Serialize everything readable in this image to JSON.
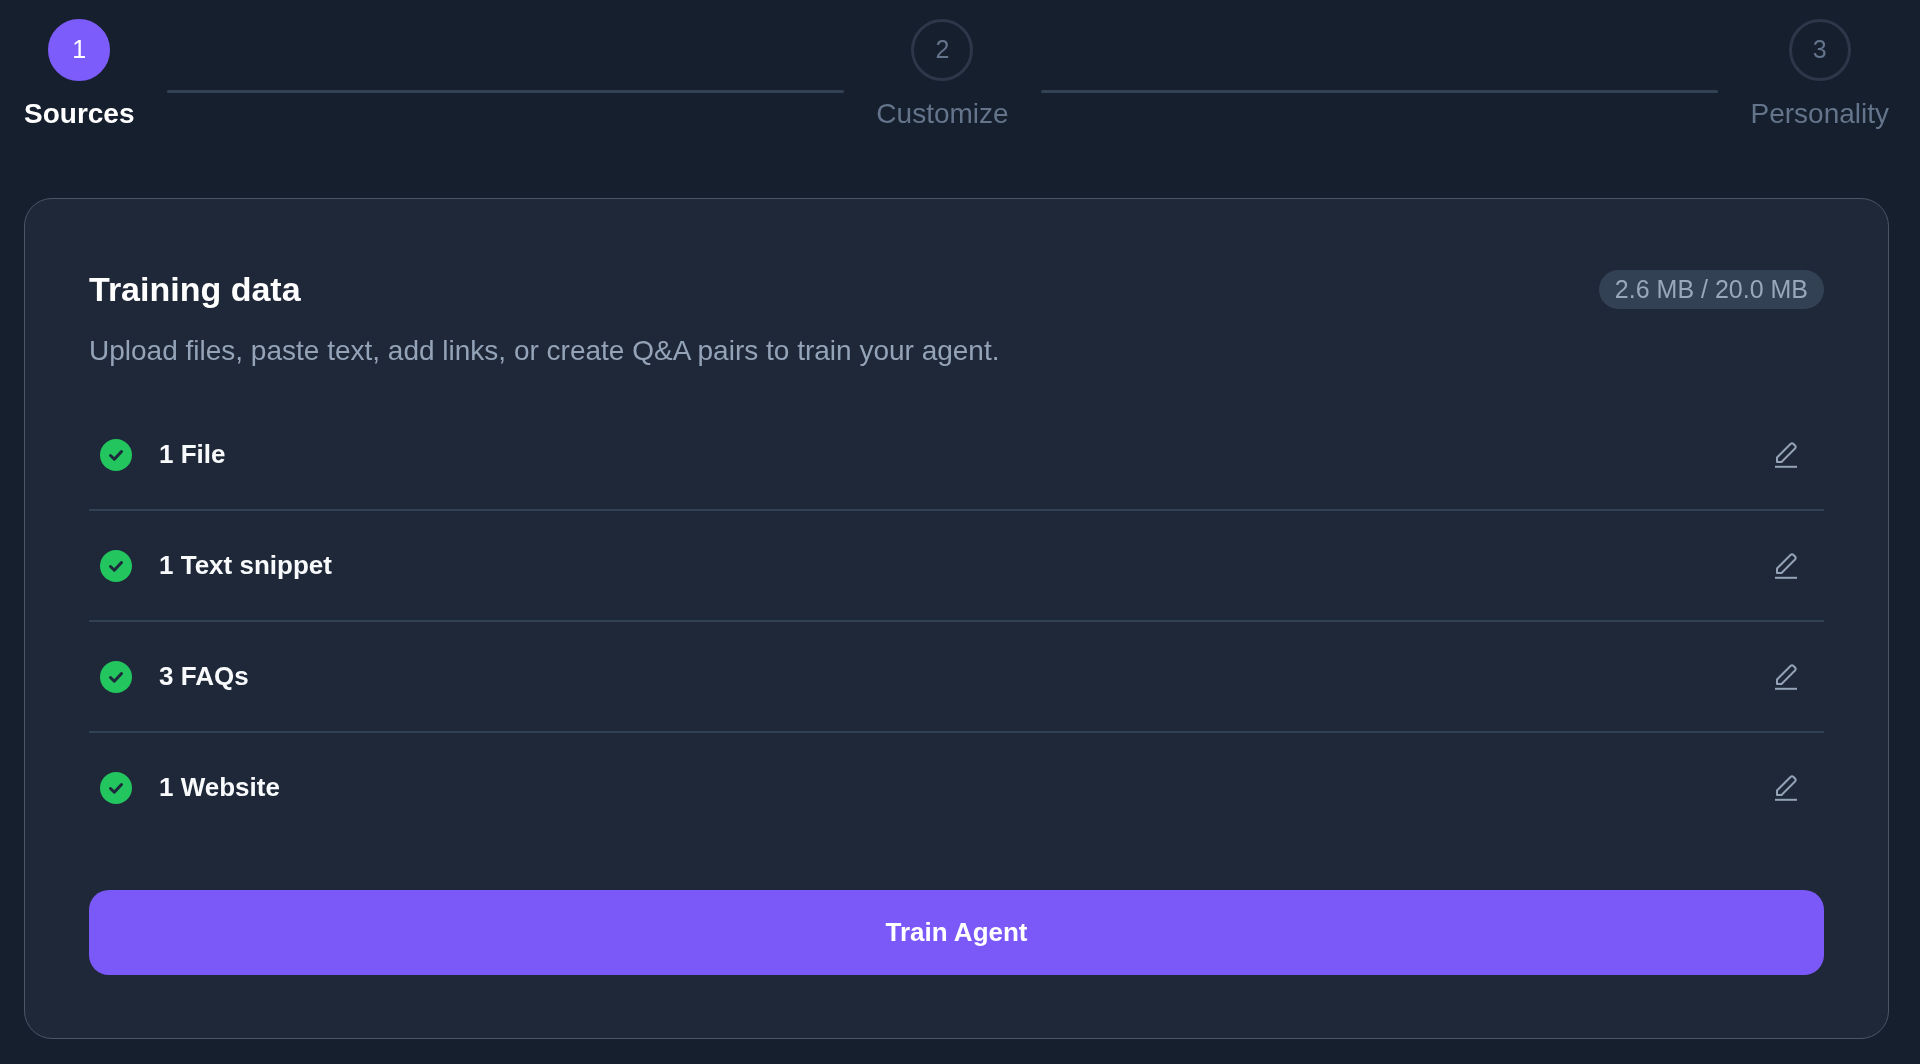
{
  "steps": [
    {
      "number": "1",
      "label": "Sources",
      "selected": true
    },
    {
      "number": "2",
      "label": "Customize",
      "selected": false
    },
    {
      "number": "3",
      "label": "Personality",
      "selected": false
    }
  ],
  "training_data": {
    "title": "Training data",
    "usage": "2.6 MB / 20.0 MB",
    "description": "Upload files, paste text, add links, or create Q&A pairs to train your agent.",
    "sources": [
      {
        "label": "1 File",
        "complete": true
      },
      {
        "label": "1 Text snippet",
        "complete": true
      },
      {
        "label": "3 FAQs",
        "complete": true
      },
      {
        "label": "1 Website",
        "complete": true
      }
    ],
    "train_button": "Train Agent"
  }
}
